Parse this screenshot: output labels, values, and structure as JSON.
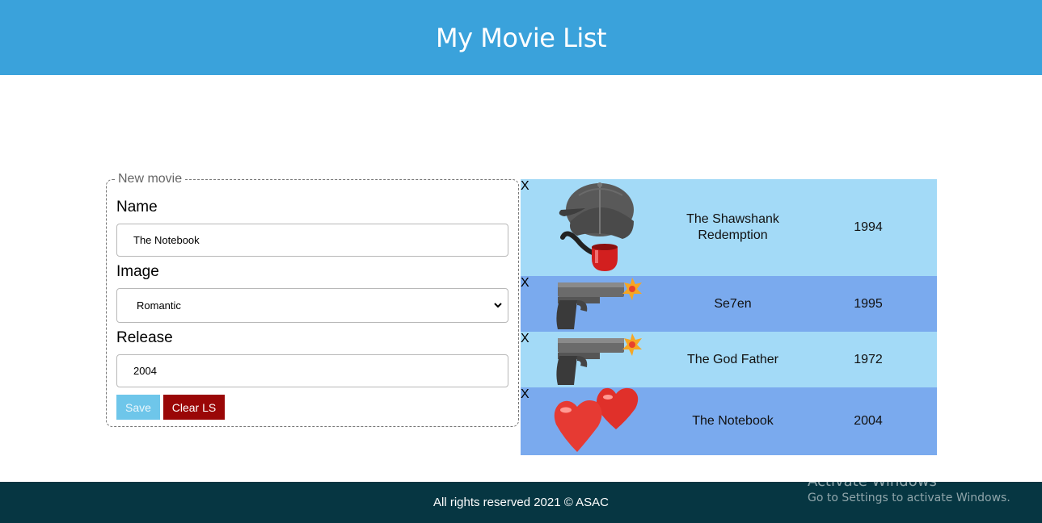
{
  "header": {
    "title": "My Movie List"
  },
  "form": {
    "legend": "New movie",
    "name_label": "Name",
    "name_value": "The Notebook",
    "image_label": "Image",
    "image_selected": "Romantic",
    "release_label": "Release",
    "release_value": "2004",
    "save_label": "Save",
    "clear_label": "Clear LS"
  },
  "movies": [
    {
      "delete_label": "X",
      "icon": "detective-hat-pipe-icon",
      "name": "The Shawshank Redemption",
      "year": "1994"
    },
    {
      "delete_label": "X",
      "icon": "pistol-icon",
      "name": "Se7en",
      "year": "1995"
    },
    {
      "delete_label": "X",
      "icon": "pistol-icon",
      "name": "The God Father",
      "year": "1972"
    },
    {
      "delete_label": "X",
      "icon": "two-hearts-icon",
      "name": "The Notebook",
      "year": "2004"
    }
  ],
  "footer": {
    "text": "All rights reserved 2021 © ASAC"
  },
  "watermark": {
    "line1": "Activate Windows",
    "line2": "Go to Settings to activate Windows."
  },
  "colors": {
    "header_bg": "#3aa2db",
    "row_light": "#a3daf7",
    "row_dark": "#7aaaee",
    "save_button": "#6ec6ea",
    "clear_button": "#9a0707",
    "footer_bg": "#063642"
  }
}
